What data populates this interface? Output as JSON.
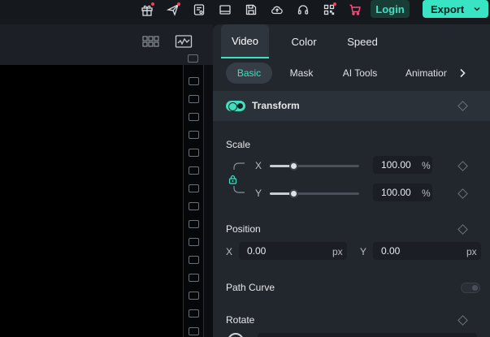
{
  "toolbar": {
    "icons": [
      "gift-icon",
      "send-icon",
      "notes-icon",
      "layout-icon",
      "save-icon",
      "cloud-upload-icon",
      "headset-icon",
      "grid-icon",
      "cart-icon"
    ],
    "login_label": "Login",
    "export_label": "Export",
    "accent": "#38e4c3",
    "notification_color": "#ff3b57"
  },
  "panel": {
    "tabs": [
      {
        "label": "Video",
        "active": true
      },
      {
        "label": "Color",
        "active": false
      },
      {
        "label": "Speed",
        "active": false
      }
    ],
    "subtabs": [
      {
        "label": "Basic",
        "active": true
      },
      {
        "label": "Mask",
        "active": false
      },
      {
        "label": "AI Tools",
        "active": false
      },
      {
        "label": "Animation",
        "active": false
      }
    ],
    "transform": {
      "title": "Transform",
      "enabled": true
    },
    "scale": {
      "label": "Scale",
      "x_label": "X",
      "y_label": "Y",
      "x_value": "100.00",
      "y_value": "100.00",
      "unit": "%",
      "x_level": 0.25,
      "y_level": 0.25,
      "locked": true
    },
    "position": {
      "label": "Position",
      "x_label": "X",
      "y_label": "Y",
      "x_value": "0.00",
      "y_value": "0.00",
      "unit": "px"
    },
    "path_curve": {
      "label": "Path Curve",
      "enabled": false
    },
    "rotate": {
      "label": "Rotate"
    }
  }
}
